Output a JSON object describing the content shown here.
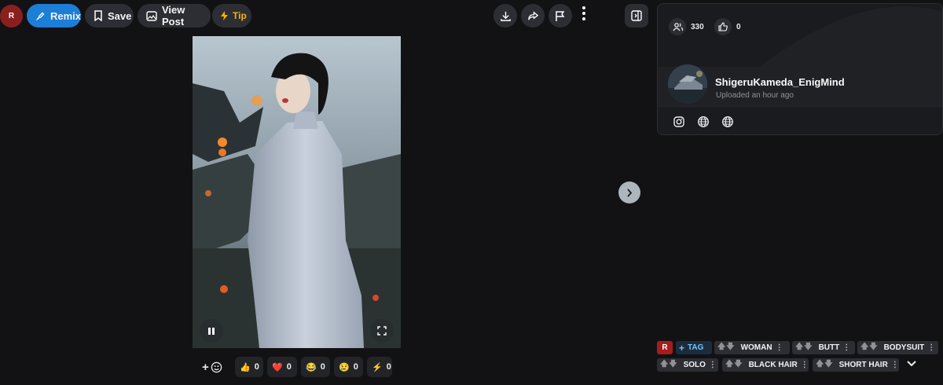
{
  "toolbar": {
    "avatar_letter": "R",
    "remix_label": "Remix",
    "save_label": "Save",
    "view_post_label": "View Post",
    "tip_label": "Tip"
  },
  "reactions": [
    {
      "emoji": "👍",
      "count": "0"
    },
    {
      "emoji": "❤️",
      "count": "0"
    },
    {
      "emoji": "😂",
      "count": "0"
    },
    {
      "emoji": "😢",
      "count": "0"
    },
    {
      "emoji": "⚡",
      "count": "0"
    }
  ],
  "add_reaction_label": "+",
  "panel": {
    "followers": "330",
    "likes": "0",
    "username": "ShigeruKameda_EnigMind",
    "uploaded": "Uploaded an hour ago",
    "social_icons": [
      "instagram-icon",
      "globe-icon",
      "globe-icon"
    ]
  },
  "tags": {
    "rating": "R",
    "add_tag_label": "TAG",
    "items": [
      "WOMAN",
      "BUTT",
      "BODYSUIT",
      "SOLO",
      "BLACK HAIR",
      "SHORT HAIR"
    ]
  },
  "colors": {
    "accent": "#228be6",
    "tip": "#fab005",
    "rating": "#c92a2a",
    "background": "#121214",
    "panel": "#1a1b1e"
  }
}
